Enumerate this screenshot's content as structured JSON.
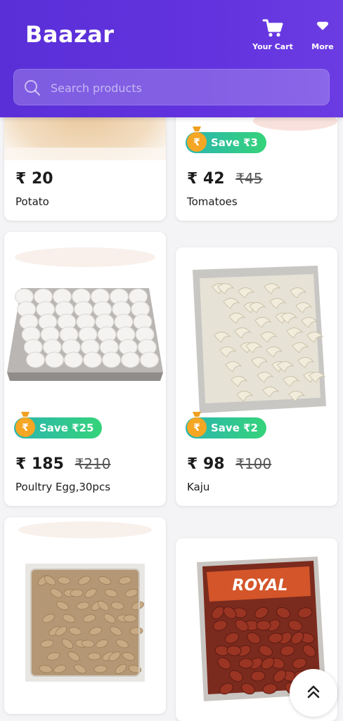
{
  "header": {
    "brand": "Baazar",
    "cart_label": "Your Cart",
    "more_label": "More",
    "search_placeholder": "Search products"
  },
  "currency_symbol": "₹",
  "products": [
    {
      "name": "Potato",
      "price": "20",
      "mrp": "",
      "save": "",
      "image": "potato-image"
    },
    {
      "name": "Tomatoes",
      "price": "42",
      "mrp": "₹45",
      "save": "Save ₹3",
      "image": "tomatoes-image"
    },
    {
      "name": "Poultry Egg,30pcs",
      "price": "185",
      "mrp": "₹210",
      "save": "Save ₹25",
      "image": "egg-tray-image"
    },
    {
      "name": "Kaju",
      "price": "98",
      "mrp": "₹100",
      "save": "Save ₹2",
      "image": "cashew-pack-image"
    },
    {
      "name": "",
      "price": "",
      "mrp": "",
      "save": "",
      "image": "raisin-box-image"
    },
    {
      "name": "",
      "price": "",
      "mrp": "",
      "save": "",
      "image": "dates-pack-image"
    }
  ],
  "dates_pack_brand": "ROYAL",
  "colors": {
    "header": "#5a2fd8",
    "badge_start": "#2bb5b0",
    "badge_end": "#35d37a",
    "coin": "#f5a623"
  }
}
